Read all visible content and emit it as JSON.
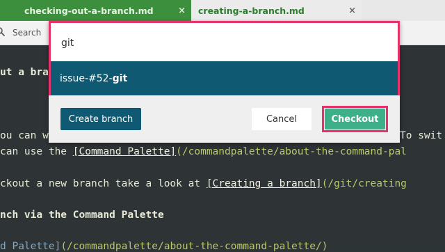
{
  "tabs": [
    {
      "label": "checking-out-a-branch.md",
      "close": "×"
    },
    {
      "label": "creating-a-branch.md",
      "close": "×"
    }
  ],
  "search": {
    "label": "Search"
  },
  "editor": {
    "line1": "ut a bra",
    "line2a": "ou can w",
    "line2b": "To swit",
    "line3_prefix": "can use the ",
    "line3_link": "[Command Palette]",
    "line3_url": "(/commandpalette/about-the-command-pal",
    "line4_prefix": "ckout a new branch take a look at ",
    "line4_link": "[Creating a branch]",
    "line4_url": "(/git/creating",
    "line5": "nch via the Command Palette",
    "line6_link": "d Palette]",
    "line6_url": "(/commandpalette/about-the-command-palette/)"
  },
  "palette": {
    "query": "git",
    "result_prefix": "issue-#52-",
    "result_match": "git",
    "create_label": "Create branch",
    "cancel_label": "Cancel",
    "checkout_label": "Checkout"
  },
  "colors": {
    "accent_highlight": "#e6336b",
    "primary": "#0f5a72",
    "checkout": "#3db08a"
  }
}
